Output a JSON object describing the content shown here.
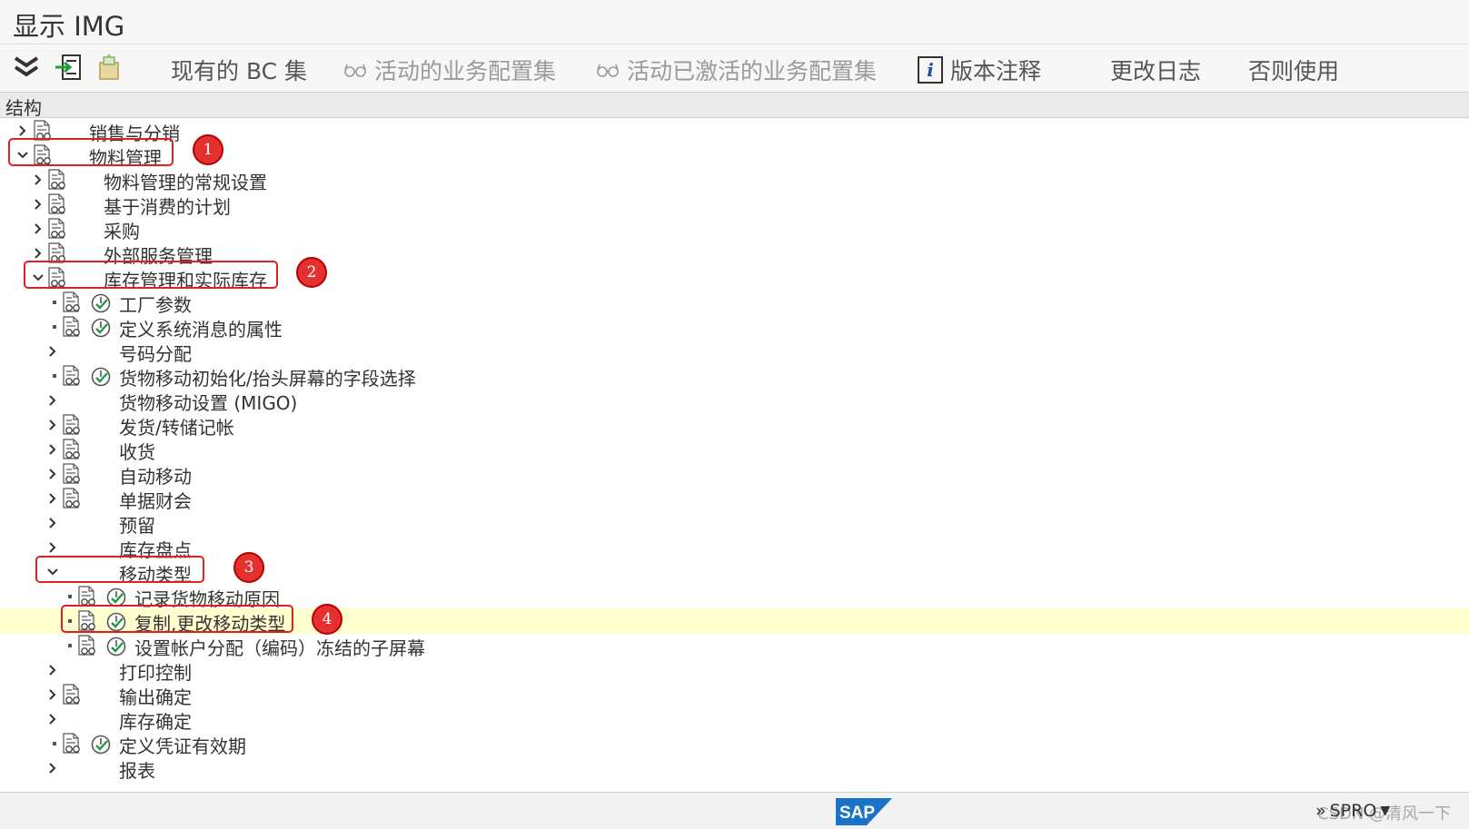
{
  "window": {
    "title": "显示 IMG"
  },
  "toolbar": {
    "bc_sets": "现有的 BC 集",
    "active_bc_sets": "活动的业务配置集",
    "activated_bc_sets": "活动已激活的业务配置集",
    "release_notes": "版本注释",
    "change_log": "更改日志",
    "otherwise_use": "否则使用"
  },
  "structure_header": "结构",
  "tree": {
    "sales": "销售与分销",
    "mm": "物料管理",
    "mm_general": "物料管理的常规设置",
    "consumption_planning": "基于消费的计划",
    "purchasing": "采购",
    "external_services": "外部服务管理",
    "inventory": "库存管理和实际库存",
    "plant_params": "工厂参数",
    "system_messages": "定义系统消息的属性",
    "number_assignment": "号码分配",
    "field_selection": "货物移动初始化/抬头屏幕的字段选择",
    "migo_settings": "货物移动设置 (MIGO)",
    "goods_issue": "发货/转储记帐",
    "goods_receipt": "收货",
    "automatic_movements": "自动移动",
    "doc_accounting": "单据财会",
    "reservation": "预留",
    "physical_inventory": "库存盘点",
    "movement_types": "移动类型",
    "record_reasons": "记录货物移动原因",
    "copy_change_mvt": "复制,更改移动类型",
    "account_assignment": "设置帐户分配（编码）冻结的子屏幕",
    "print_control": "打印控制",
    "output_determination": "输出确定",
    "stock_determination": "库存确定",
    "doc_validity": "定义凭证有效期",
    "reports": "报表"
  },
  "callouts": [
    "1",
    "2",
    "3",
    "4"
  ],
  "statusbar": {
    "logo": "SAP",
    "transaction": "SPRO",
    "watermark": "CSDN @清风一下"
  },
  "colors": {
    "highlight": "#ffffcf",
    "annotation_red": "#e02020",
    "sap_blue": "#1a73c7"
  }
}
